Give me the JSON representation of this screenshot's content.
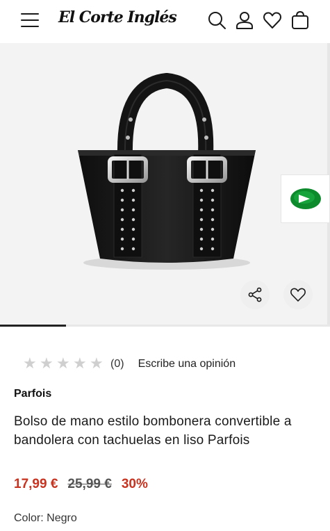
{
  "header": {
    "logo_text": "El Corte Inglés",
    "icons": [
      "menu-icon",
      "search-icon",
      "user-icon",
      "heart-icon",
      "bag-icon"
    ]
  },
  "gallery": {
    "image_progress_fraction": 0.2,
    "icons": [
      "share-icon",
      "heart-icon",
      "play-icon"
    ],
    "promo_color": "#0c8a2c"
  },
  "rating": {
    "stars_filled": 0,
    "stars_total": 5,
    "count": "(0)",
    "write_review": "Escribe una opinión"
  },
  "product": {
    "brand": "Parfois",
    "title": "Bolso de mano estilo bombonera convertible a bandolera con tachuelas en liso Parfois",
    "price_current": "17,99 €",
    "price_old": "25,99 €",
    "discount": "30%",
    "color_label": "Color:",
    "color_value": "Negro"
  },
  "colors": {
    "accent_red": "#c8321e",
    "text": "#1a1a1a",
    "star_empty": "#cfcfcf"
  }
}
